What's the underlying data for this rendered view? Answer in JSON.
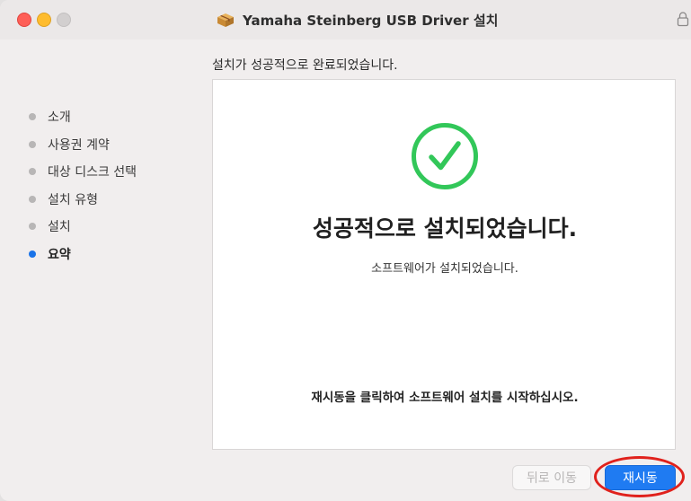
{
  "window": {
    "title": "Yamaha Steinberg USB Driver 설치"
  },
  "page": {
    "heading": "설치가 성공적으로 완료되었습니다."
  },
  "sidebar": {
    "items": [
      {
        "label": "소개",
        "active": false
      },
      {
        "label": "사용권 계약",
        "active": false
      },
      {
        "label": "대상 디스크 선택",
        "active": false
      },
      {
        "label": "설치 유형",
        "active": false
      },
      {
        "label": "설치",
        "active": false
      },
      {
        "label": "요약",
        "active": true
      }
    ]
  },
  "content": {
    "success_title": "성공적으로 설치되었습니다.",
    "success_subtitle": "소프트웨어가 설치되었습니다.",
    "instruction": "재시동을 클릭하여 소프트웨어 설치를 시작하십시오."
  },
  "buttons": {
    "back_label": "뒤로 이동",
    "restart_label": "재시동"
  },
  "colors": {
    "success_green": "#32c759",
    "accent_blue": "#1f7bf2",
    "annotation_red": "#e0211c"
  },
  "icons": {
    "title": "package-icon",
    "lock": "lock-icon",
    "success": "checkmark-circle-icon"
  }
}
